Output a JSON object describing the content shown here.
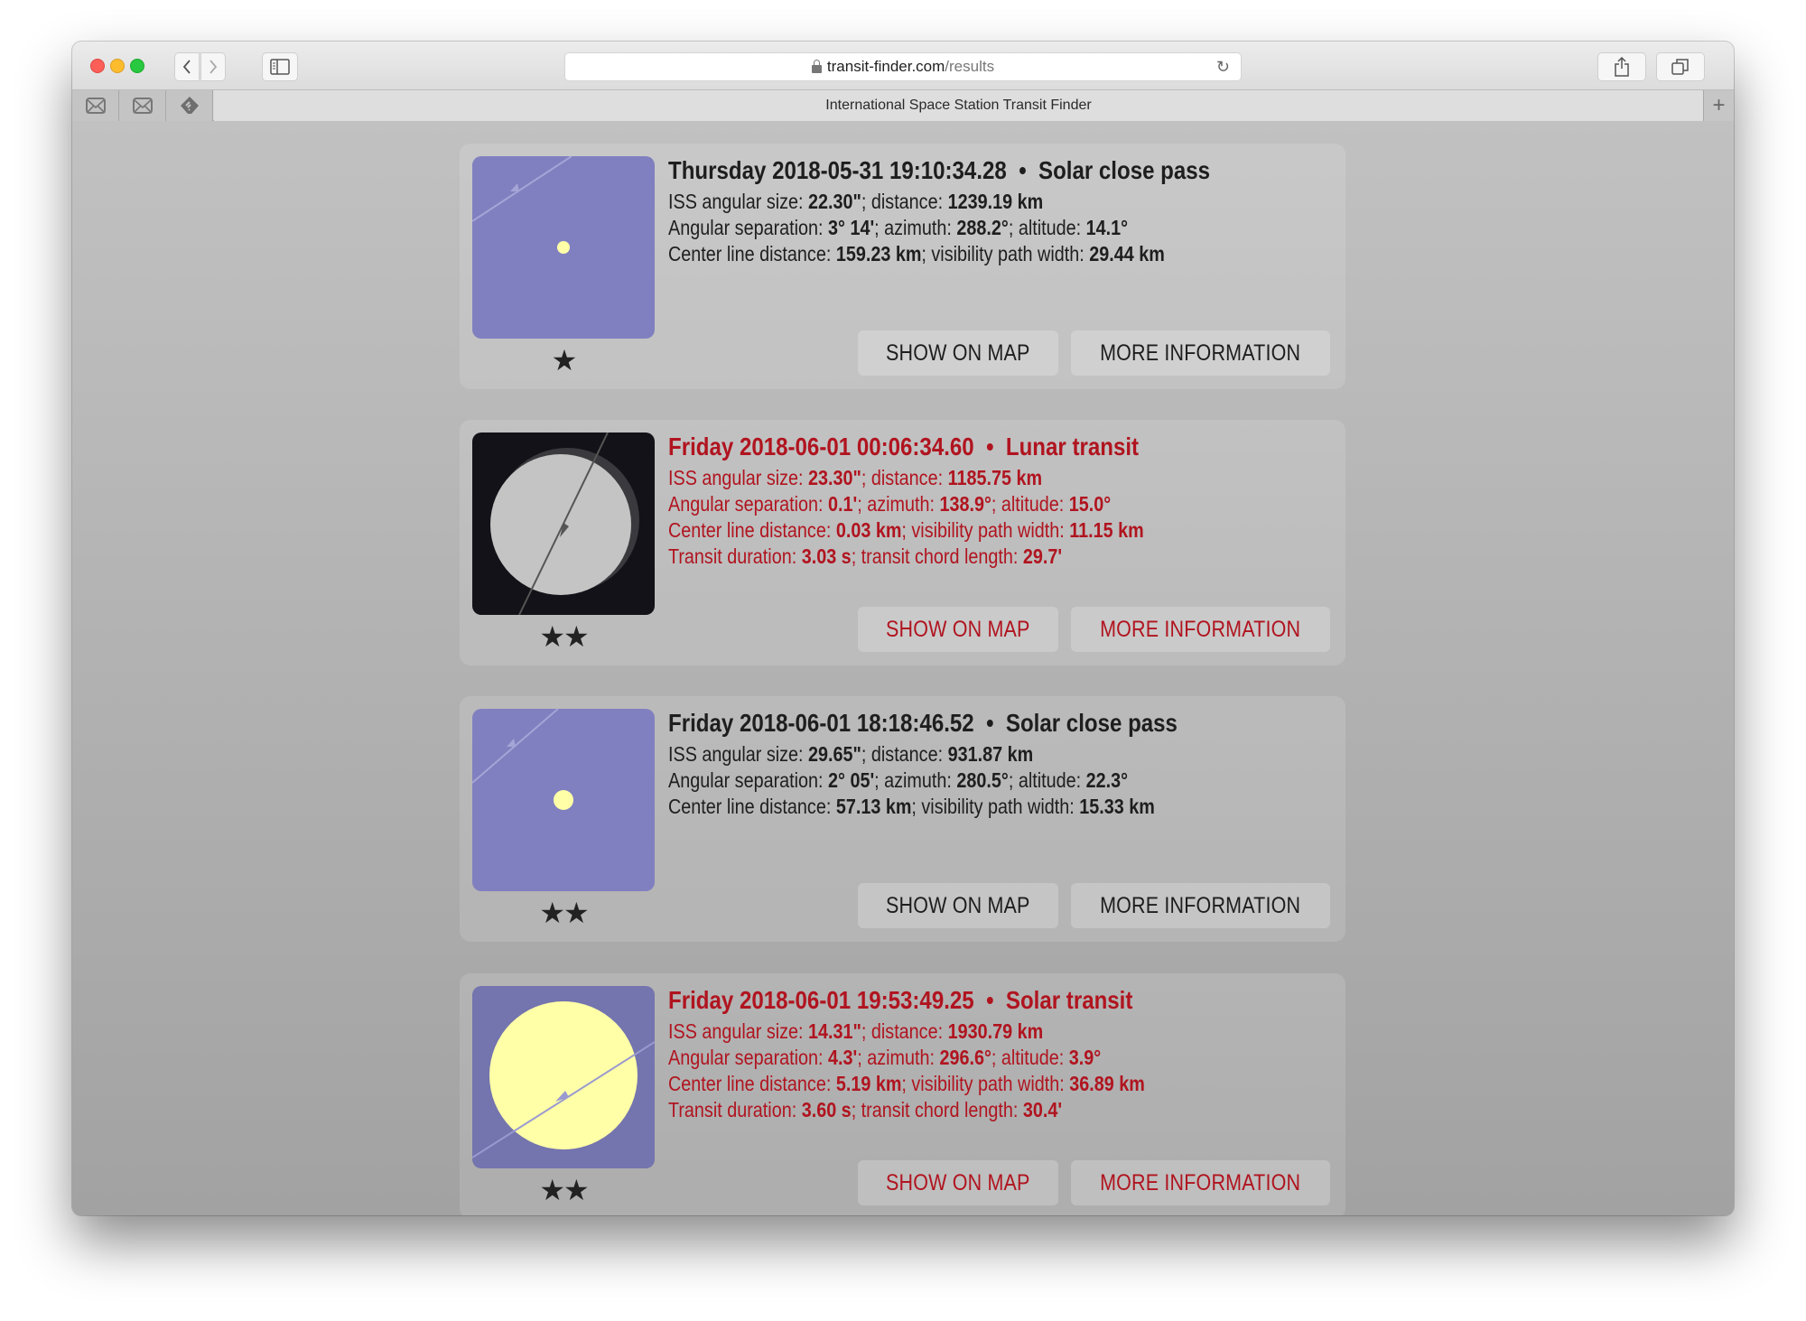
{
  "browser": {
    "url_host": "transit-finder.com",
    "url_path": "/results",
    "tab_title": "International Space Station Transit Finder",
    "pinned_tabs": [
      "mail-icon",
      "mail-icon",
      "feedly-icon"
    ],
    "new_tab_label": "+"
  },
  "buttons": {
    "show_on_map": "SHOW ON MAP",
    "more_information": "MORE INFORMATION"
  },
  "results": [
    {
      "date": "Thursday 2018-05-31 19:10:34.28",
      "type": "Solar close pass",
      "highlight": false,
      "thumbnail": "solar-close-pass",
      "stars": "★",
      "rating": 1,
      "iss_angular_size": "22.30\"",
      "distance": "1239.19 km",
      "angular_separation": "3° 14'",
      "azimuth": "288.2°",
      "altitude": "14.1°",
      "center_line_distance": "159.23 km",
      "visibility_path_width": "29.44 km"
    },
    {
      "date": "Friday 2018-06-01 00:06:34.60",
      "type": "Lunar transit",
      "highlight": true,
      "thumbnail": "lunar-transit",
      "stars": "★★",
      "rating": 2,
      "iss_angular_size": "23.30\"",
      "distance": "1185.75 km",
      "angular_separation": "0.1'",
      "azimuth": "138.9°",
      "altitude": "15.0°",
      "center_line_distance": "0.03 km",
      "visibility_path_width": "11.15 km",
      "transit_duration": "3.03 s",
      "transit_chord_length": "29.7'"
    },
    {
      "date": "Friday 2018-06-01 18:18:46.52",
      "type": "Solar close pass",
      "highlight": false,
      "thumbnail": "solar-close-pass",
      "stars": "★★",
      "rating": 2,
      "iss_angular_size": "29.65\"",
      "distance": "931.87 km",
      "angular_separation": "2° 05'",
      "azimuth": "280.5°",
      "altitude": "22.3°",
      "center_line_distance": "57.13 km",
      "visibility_path_width": "15.33 km"
    },
    {
      "date": "Friday 2018-06-01 19:53:49.25",
      "type": "Solar transit",
      "highlight": true,
      "thumbnail": "solar-transit",
      "stars": "★★",
      "rating": 2,
      "iss_angular_size": "14.31\"",
      "distance": "1930.79 km",
      "angular_separation": "4.3'",
      "azimuth": "296.6°",
      "altitude": "3.9°",
      "center_line_distance": "5.19 km",
      "visibility_path_width": "36.89 km",
      "transit_duration": "3.60 s",
      "transit_chord_length": "30.4'"
    }
  ],
  "labels": {
    "iss_angular_size": "ISS angular size: ",
    "distance": "; distance: ",
    "angular_separation": "Angular separation: ",
    "azimuth": "; azimuth: ",
    "altitude": "; altitude: ",
    "center_line_distance": "Center line distance: ",
    "visibility_path_width": "; visibility path width: ",
    "transit_duration": "Transit duration: ",
    "transit_chord_length": "; transit chord length: ",
    "separator": "  •  "
  },
  "colors": {
    "highlight_text": "#b0141f",
    "normal_text": "#1e1e1e",
    "sky_blue": "#8080c0",
    "sky_blue_dark": "#7474ae",
    "sun_yellow": "#ffffa8",
    "night": "#121218",
    "moon": "#c4c4c4"
  }
}
